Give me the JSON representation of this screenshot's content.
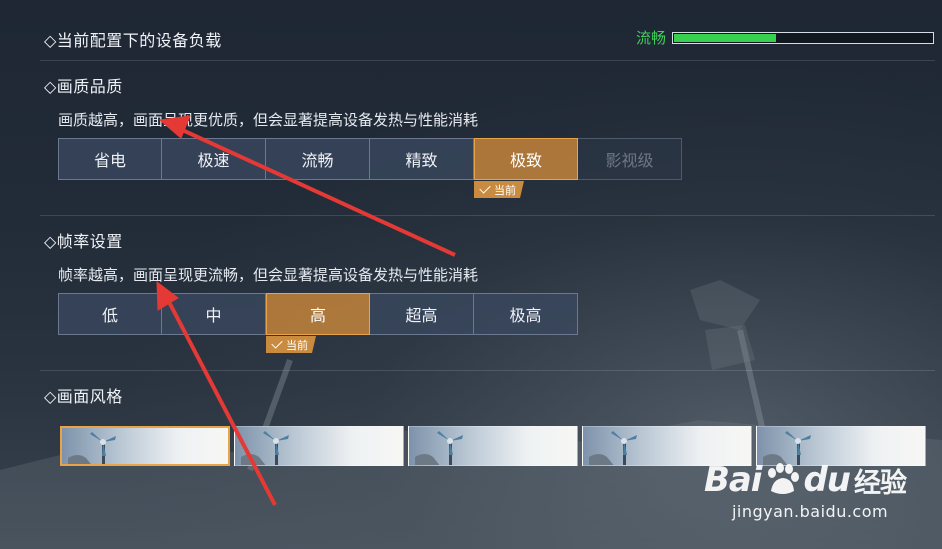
{
  "load": {
    "title": "◇当前配置下的设备负载",
    "status_label": "流畅",
    "bar_fraction": 0.4,
    "bar_color": "#38d14f"
  },
  "quality": {
    "title": "◇画质品质",
    "description": "画质越高，画面呈现更优质，但会显著提高设备发热与性能消耗",
    "options": [
      "省电",
      "极速",
      "流畅",
      "精致",
      "极致",
      "影视级"
    ],
    "selected_index": 4,
    "disabled_index": 5,
    "current_tag": "当前"
  },
  "framerate": {
    "title": "◇帧率设置",
    "description": "帧率越高，画面呈现更流畅，但会显著提高设备发热与性能消耗",
    "options": [
      "低",
      "中",
      "高",
      "超高",
      "极高"
    ],
    "selected_index": 2,
    "current_tag": "当前"
  },
  "style": {
    "title": "◇画面风格",
    "thumbnail_count": 5,
    "selected_index": 0
  },
  "watermark": {
    "brand_prefix": "Bai",
    "brand_suffix": "du",
    "brand_cn": "经验",
    "url": "jingyan.baidu.com"
  },
  "colors": {
    "accent": "#e9a44a",
    "annotation_arrow": "#e53935"
  }
}
